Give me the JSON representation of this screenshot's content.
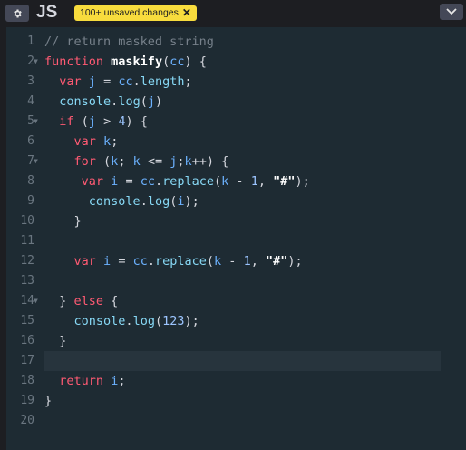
{
  "header": {
    "language_title": "JS",
    "unsaved_badge": "100+ unsaved changes",
    "settings_icon": "gear-icon",
    "close_icon": "close-icon",
    "collapse_icon": "chevron-down-icon"
  },
  "colors": {
    "background": "#1d1e22",
    "editor_bg": "#1e2b33",
    "badge": "#f8dc3d",
    "keyword": "#ff5a73",
    "variable": "#6cb2ff"
  },
  "editor": {
    "line_numbers": [
      "1",
      "2",
      "3",
      "4",
      "5",
      "6",
      "7",
      "8",
      "9",
      "10",
      "11",
      "12",
      "13",
      "14",
      "15",
      "16",
      "17",
      "18",
      "19",
      "20"
    ],
    "fold_lines": [
      2,
      5,
      7,
      14
    ],
    "active_line": 17,
    "lines": [
      [
        [
          "c",
          "// return masked string"
        ]
      ],
      [
        [
          "k",
          "function"
        ],
        [
          "o",
          " "
        ],
        [
          "f",
          "maskify"
        ],
        [
          "o",
          "("
        ],
        [
          "v",
          "cc"
        ],
        [
          "o",
          ") {"
        ]
      ],
      [
        [
          "o",
          "  "
        ],
        [
          "k",
          "var"
        ],
        [
          "o",
          " "
        ],
        [
          "v",
          "j"
        ],
        [
          "o",
          " = "
        ],
        [
          "v",
          "cc"
        ],
        [
          "o",
          "."
        ],
        [
          "p",
          "length"
        ],
        [
          "o",
          ";"
        ]
      ],
      [
        [
          "o",
          "  "
        ],
        [
          "p",
          "console"
        ],
        [
          "o",
          "."
        ],
        [
          "p",
          "log"
        ],
        [
          "o",
          "("
        ],
        [
          "v",
          "j"
        ],
        [
          "o",
          ")"
        ]
      ],
      [
        [
          "o",
          "  "
        ],
        [
          "k",
          "if"
        ],
        [
          "o",
          " ("
        ],
        [
          "v",
          "j"
        ],
        [
          "o",
          " > "
        ],
        [
          "n",
          "4"
        ],
        [
          "o",
          ") {"
        ]
      ],
      [
        [
          "o",
          "    "
        ],
        [
          "k",
          "var"
        ],
        [
          "o",
          " "
        ],
        [
          "v",
          "k"
        ],
        [
          "o",
          ";"
        ]
      ],
      [
        [
          "o",
          "    "
        ],
        [
          "k",
          "for"
        ],
        [
          "o",
          " ("
        ],
        [
          "v",
          "k"
        ],
        [
          "o",
          "; "
        ],
        [
          "v",
          "k"
        ],
        [
          "o",
          " <= "
        ],
        [
          "v",
          "j"
        ],
        [
          "o",
          ";"
        ],
        [
          "v",
          "k"
        ],
        [
          "o",
          "++) {"
        ]
      ],
      [
        [
          "o",
          "     "
        ],
        [
          "k",
          "var"
        ],
        [
          "o",
          " "
        ],
        [
          "v",
          "i"
        ],
        [
          "o",
          " = "
        ],
        [
          "v",
          "cc"
        ],
        [
          "o",
          "."
        ],
        [
          "p",
          "replace"
        ],
        [
          "o",
          "("
        ],
        [
          "v",
          "k"
        ],
        [
          "o",
          " - "
        ],
        [
          "n",
          "1"
        ],
        [
          "o",
          ", "
        ],
        [
          "s",
          "\"#\""
        ],
        [
          "o",
          ");"
        ]
      ],
      [
        [
          "o",
          "      "
        ],
        [
          "p",
          "console"
        ],
        [
          "o",
          "."
        ],
        [
          "p",
          "log"
        ],
        [
          "o",
          "("
        ],
        [
          "v",
          "i"
        ],
        [
          "o",
          ");"
        ]
      ],
      [
        [
          "o",
          "    }"
        ]
      ],
      [],
      [
        [
          "o",
          "    "
        ],
        [
          "k",
          "var"
        ],
        [
          "o",
          " "
        ],
        [
          "v",
          "i"
        ],
        [
          "o",
          " = "
        ],
        [
          "v",
          "cc"
        ],
        [
          "o",
          "."
        ],
        [
          "p",
          "replace"
        ],
        [
          "o",
          "("
        ],
        [
          "v",
          "k"
        ],
        [
          "o",
          " - "
        ],
        [
          "n",
          "1"
        ],
        [
          "o",
          ", "
        ],
        [
          "s",
          "\"#\""
        ],
        [
          "o",
          ");"
        ]
      ],
      [],
      [
        [
          "o",
          "  } "
        ],
        [
          "k",
          "else"
        ],
        [
          "o",
          " {"
        ]
      ],
      [
        [
          "o",
          "    "
        ],
        [
          "p",
          "console"
        ],
        [
          "o",
          "."
        ],
        [
          "p",
          "log"
        ],
        [
          "o",
          "("
        ],
        [
          "n",
          "123"
        ],
        [
          "o",
          ");"
        ]
      ],
      [
        [
          "o",
          "  }"
        ]
      ],
      [],
      [
        [
          "o",
          "  "
        ],
        [
          "k",
          "return"
        ],
        [
          "o",
          " "
        ],
        [
          "v",
          "i"
        ],
        [
          "o",
          ";"
        ]
      ],
      [
        [
          "o",
          "}"
        ]
      ],
      []
    ]
  }
}
